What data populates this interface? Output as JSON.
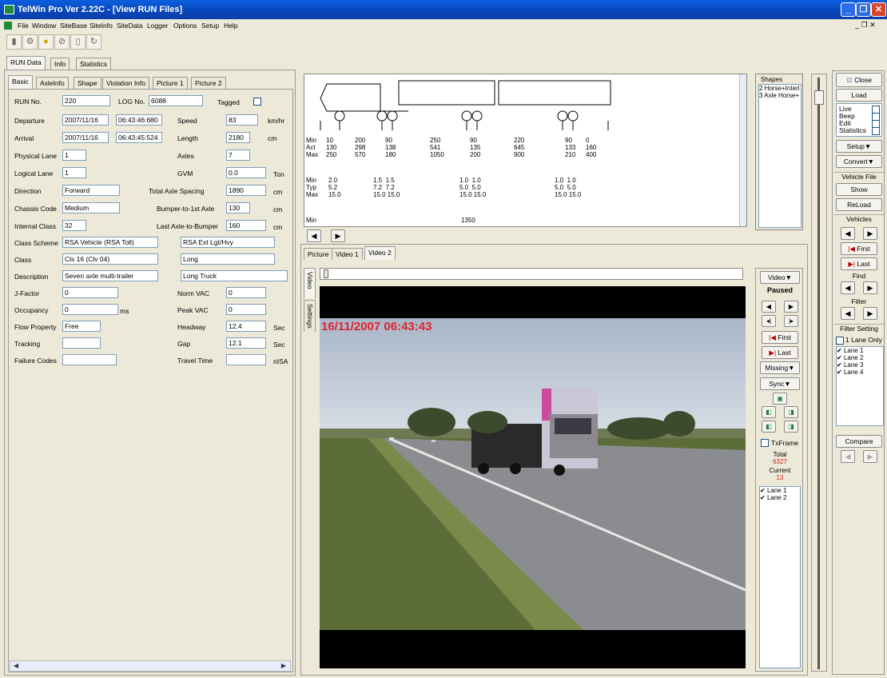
{
  "window": {
    "title": "TelWin Pro Ver 2.22C - [View RUN Files]"
  },
  "menu": [
    "File",
    "Window",
    "SiteBase",
    "SiteInfo",
    "SiteData",
    "Logger",
    "Options",
    "Setup",
    "Help"
  ],
  "main_tabs": [
    "RUN Data",
    "Info",
    "Statistics"
  ],
  "sub_tabs": [
    "Basic",
    "AxleInfo",
    "Shape",
    "Violation Info",
    "Picture 1",
    "Picture 2"
  ],
  "basic": {
    "run_no_label": "RUN No.",
    "run_no": "220",
    "log_no_label": "LOG No.",
    "log_no": "6088",
    "tagged_label": "Tagged",
    "departure_label": "Departure",
    "departure_date": "2007/11/16",
    "departure_time": "06:43:46:680",
    "arrival_label": "Arrival",
    "arrival_date": "2007/11/16",
    "arrival_time": "06:43:45:524",
    "speed_label": "Speed",
    "speed": "83",
    "speed_unit": "km/hr",
    "length_label": "Length",
    "length": "2180",
    "length_unit": "cm",
    "phys_lane_label": "Physical Lane",
    "phys_lane": "1",
    "axles_label": "Axles",
    "axles": "7",
    "log_lane_label": "Logical Lane",
    "log_lane": "1",
    "gvm_label": "GVM",
    "gvm": "0.0",
    "gvm_unit": "Ton",
    "direction_label": "Direction",
    "direction": "Forward",
    "tas_label": "Total Axle Spacing",
    "tas": "1890",
    "tas_unit": "cm",
    "chassis_label": "Chassis Code",
    "chassis": "Medium",
    "b2a_label": "Bumper-to-1st Axle",
    "b2a": "130",
    "b2a_unit": "cm",
    "internal_label": "Internal Class",
    "internal": "32",
    "la2b_label": "Last Axle-to-Bumper",
    "la2b": "160",
    "la2b_unit": "cm",
    "scheme_label": "Class Scheme",
    "scheme": "RSA Vehicle (RSA Toll)",
    "scheme2": "RSA Ext Lgt/Hvy",
    "class_label": "Class",
    "class": "Cls 16 (Clv 04)",
    "class2": "Long",
    "desc_label": "Description",
    "desc": "Seven axle multi-trailer",
    "desc2": "Long Truck",
    "jfactor_label": "J-Factor",
    "jfactor": "0",
    "norm_vac_label": "Norm VAC",
    "norm_vac": "0",
    "occ_label": "Occupancy",
    "occ": "0",
    "occ_unit": "ms",
    "peak_vac_label": "Peak VAC",
    "peak_vac": "0",
    "flow_label": "Flow Property",
    "flow": "Free",
    "headway_label": "Headway",
    "headway": "12.4",
    "headway_unit": "Sec",
    "tracking_label": "Tracking",
    "tracking": "",
    "gap_label": "Gap",
    "gap": "12.1",
    "gap_unit": "Sec",
    "failure_label": "Failure Codes",
    "failure": "",
    "travel_label": "Travel Time",
    "travel": "",
    "travel_unit": "nISA"
  },
  "diagram": {
    "rows1": "Min\nAct\nMax",
    "rows2": "Min\nTyp\nMax",
    "rows3": "Min",
    "cols": [
      "10\n130\n250",
      "200\n298\n570",
      "90\n138\n180",
      "250\n541\n1050",
      "90\n135\n200",
      "220\n645\n900",
      "90\n133\n210",
      "0\n160\n400"
    ],
    "typ": [
      "2.0\n5.2\n15.0",
      "1.5  1.5\n7.2  7.2\n15.0 15.0",
      "1.0  1.0\n5.0  5.0\n15.0 15.0",
      "1.0  1.0\n5.0  5.0\n15.0 15.0"
    ],
    "min_val": "1350"
  },
  "shapes": {
    "title": "Shapes",
    "items": [
      "2 Horse+Interl",
      "3 Axle Horse+"
    ]
  },
  "video_tabs": [
    "Picture",
    "Video 1",
    "Video 2"
  ],
  "video_side_tabs": [
    "Video",
    "Settings"
  ],
  "video": {
    "timestamp": "16/11/2007 06:43:43"
  },
  "video_controls": {
    "video_btn": "Video▼",
    "state": "Paused",
    "first": "First",
    "last": "Last",
    "missing": "Missing▼",
    "sync": "Sync▼",
    "tframe": "TxFrame",
    "total_label": "Total",
    "total": "6327",
    "current_label": "Current",
    "current": "13",
    "lanes": [
      "Lane 1",
      "Lane 2"
    ]
  },
  "right_panel": {
    "close": "Close",
    "load": "Load",
    "checks": [
      "Live",
      "Beep",
      "Edit",
      "Statistics"
    ],
    "setup": "Setup▼",
    "convert": "Convert▼",
    "vehicle_file": "Vehicle File",
    "show": "Show",
    "reload": "ReLoad",
    "vehicles": "Vehicles",
    "first": "First",
    "last": "Last",
    "find": "Find",
    "filter": "Filter",
    "filter_setting": "Filter Setting",
    "one_lane": "1 Lane Only",
    "lanes": [
      "Lane 1",
      "Lane 2",
      "Lane 3",
      "Lane 4"
    ],
    "compare": "Compare"
  }
}
